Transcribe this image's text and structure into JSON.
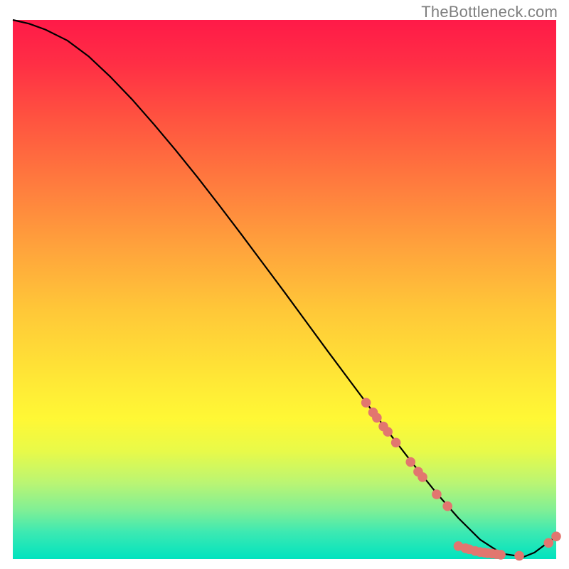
{
  "watermark": "TheBottleneck.com",
  "chart_data": {
    "type": "line",
    "title": "",
    "xlabel": "",
    "ylabel": "",
    "xlim": [
      0,
      100
    ],
    "ylim": [
      0,
      100
    ],
    "grid": false,
    "legend": false,
    "gradient_colors": {
      "top": "#ff1a48",
      "mid": "#ffe636",
      "bottom": "#00e3bf"
    },
    "series": [
      {
        "name": "bottleneck-curve",
        "x": [
          0,
          3,
          6,
          10,
          14,
          18,
          22,
          26,
          30,
          34,
          38,
          42,
          46,
          50,
          54,
          58,
          62,
          66,
          70,
          74,
          78,
          82,
          86,
          90,
          94,
          96,
          100
        ],
        "y": [
          100,
          99.3,
          98.2,
          96.2,
          93.2,
          89.4,
          85.2,
          80.6,
          75.8,
          70.8,
          65.6,
          60.3,
          54.9,
          49.5,
          44.0,
          38.5,
          33.1,
          27.7,
          22.4,
          17.2,
          12.2,
          7.6,
          3.6,
          1.0,
          0.4,
          1.2,
          4.2
        ]
      }
    ],
    "points": [
      {
        "x": 65.0,
        "y": 29.0
      },
      {
        "x": 66.3,
        "y": 27.2
      },
      {
        "x": 67.0,
        "y": 26.2
      },
      {
        "x": 68.2,
        "y": 24.6
      },
      {
        "x": 69.0,
        "y": 23.6
      },
      {
        "x": 70.5,
        "y": 21.6
      },
      {
        "x": 73.2,
        "y": 18.0
      },
      {
        "x": 74.6,
        "y": 16.2
      },
      {
        "x": 75.4,
        "y": 15.2
      },
      {
        "x": 78.0,
        "y": 12.0
      },
      {
        "x": 80.0,
        "y": 9.8
      },
      {
        "x": 82.0,
        "y": 2.4
      },
      {
        "x": 83.3,
        "y": 2.0
      },
      {
        "x": 84.0,
        "y": 1.8
      },
      {
        "x": 85.1,
        "y": 1.5
      },
      {
        "x": 86.0,
        "y": 1.3
      },
      {
        "x": 86.8,
        "y": 1.2
      },
      {
        "x": 87.4,
        "y": 1.1
      },
      {
        "x": 88.2,
        "y": 1.0
      },
      {
        "x": 89.0,
        "y": 0.9
      },
      {
        "x": 89.8,
        "y": 0.8
      },
      {
        "x": 93.2,
        "y": 0.6
      },
      {
        "x": 98.6,
        "y": 3.0
      },
      {
        "x": 100.0,
        "y": 4.2
      }
    ],
    "point_color": "#e2766f",
    "line_color": "#000000"
  }
}
